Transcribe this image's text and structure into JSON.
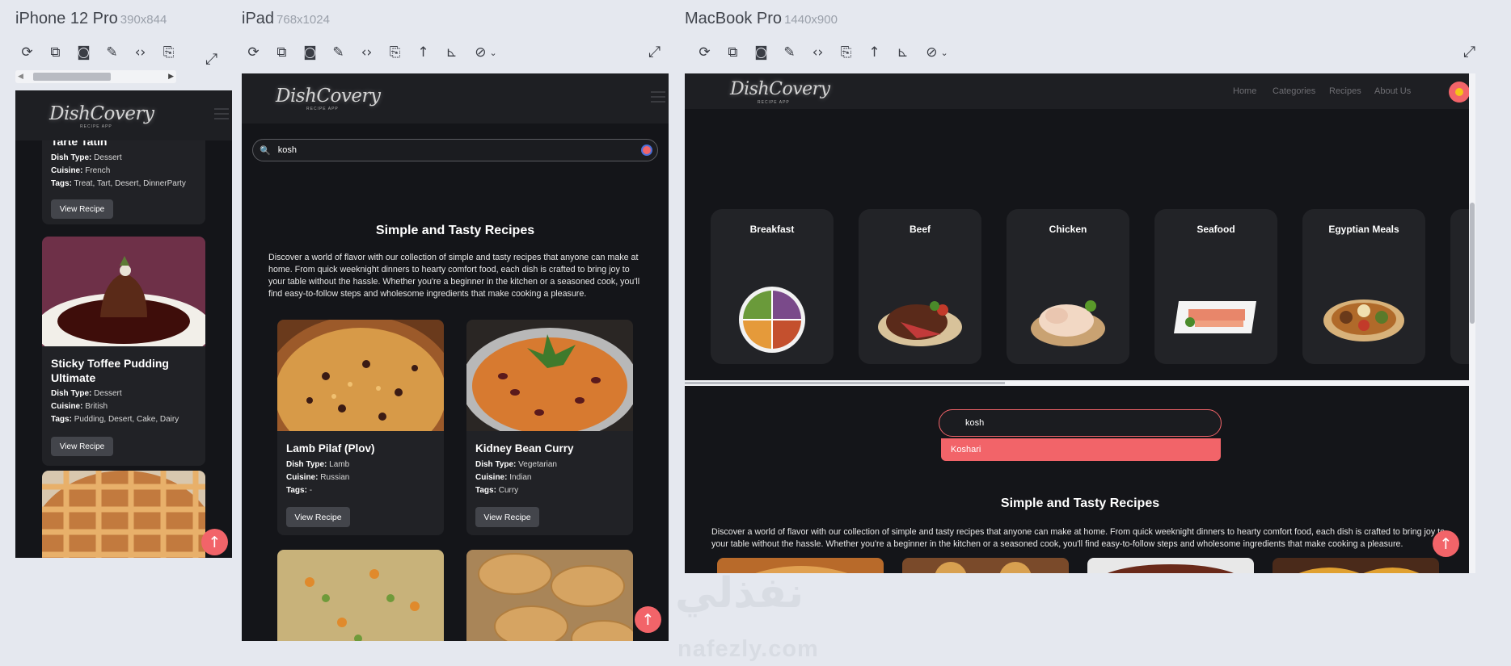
{
  "devices": {
    "iphone": {
      "name": "iPhone 12 Pro",
      "size": "390x844"
    },
    "ipad": {
      "name": "iPad",
      "size": "768x1024"
    },
    "macbook": {
      "name": "MacBook Pro",
      "size": "1440x900"
    }
  },
  "toolbar_icons": [
    "reload-icon",
    "screenshot-full-icon",
    "camera-icon",
    "eyedropper-icon",
    "code-icon",
    "rotate-icon",
    "scroll-up-icon",
    "ruler-icon",
    "hide-icon",
    "dropdown-icon",
    "fullscreen-icon"
  ],
  "site": {
    "logo": "DishCovery",
    "logo_sub": "RECIPE APP",
    "nav": [
      "Home",
      "Categories",
      "Recipes",
      "About Us"
    ],
    "search_value": "kosh",
    "suggestion": "Koshari",
    "section_title": "Simple and Tasty Recipes",
    "intro": "Discover a world of flavor with our collection of simple and tasty recipes that anyone can make at home. From quick weeknight dinners to hearty comfort food, each dish is crafted to bring joy to your table without the hassle. Whether you're a beginner in the kitchen or a seasoned cook, you'll find easy-to-follow steps and wholesome ingredients that make cooking a pleasure.",
    "labels": {
      "dish_type": "Dish Type:",
      "cuisine": "Cuisine:",
      "tags": "Tags:"
    },
    "view_recipe": "View Recipe"
  },
  "iphone_recipes": [
    {
      "title": "Tarte Tatin",
      "dish_type": "Dessert",
      "cuisine": "French",
      "tags": "Treat, Tart, Desert, DinnerParty"
    },
    {
      "title": "Sticky Toffee Pudding Ultimate",
      "dish_type": "Dessert",
      "cuisine": "British",
      "tags": "Pudding, Desert, Cake, Dairy"
    }
  ],
  "ipad_recipes": [
    {
      "title": "Lamb Pilaf (Plov)",
      "dish_type": "Lamb",
      "cuisine": "Russian",
      "tags": "-"
    },
    {
      "title": "Kidney Bean Curry",
      "dish_type": "Vegetarian",
      "cuisine": "Indian",
      "tags": "Curry"
    }
  ],
  "categories": [
    "Breakfast",
    "Beef",
    "Chicken",
    "Seafood",
    "Egyptian Meals"
  ],
  "watermark": {
    "arabic": "نفذلي",
    "latin": "nafezly.com"
  },
  "colors": {
    "accent": "#f26469",
    "page_bg": "#141519",
    "card_bg": "#212226",
    "chrome_bg": "#e5e8ef"
  }
}
